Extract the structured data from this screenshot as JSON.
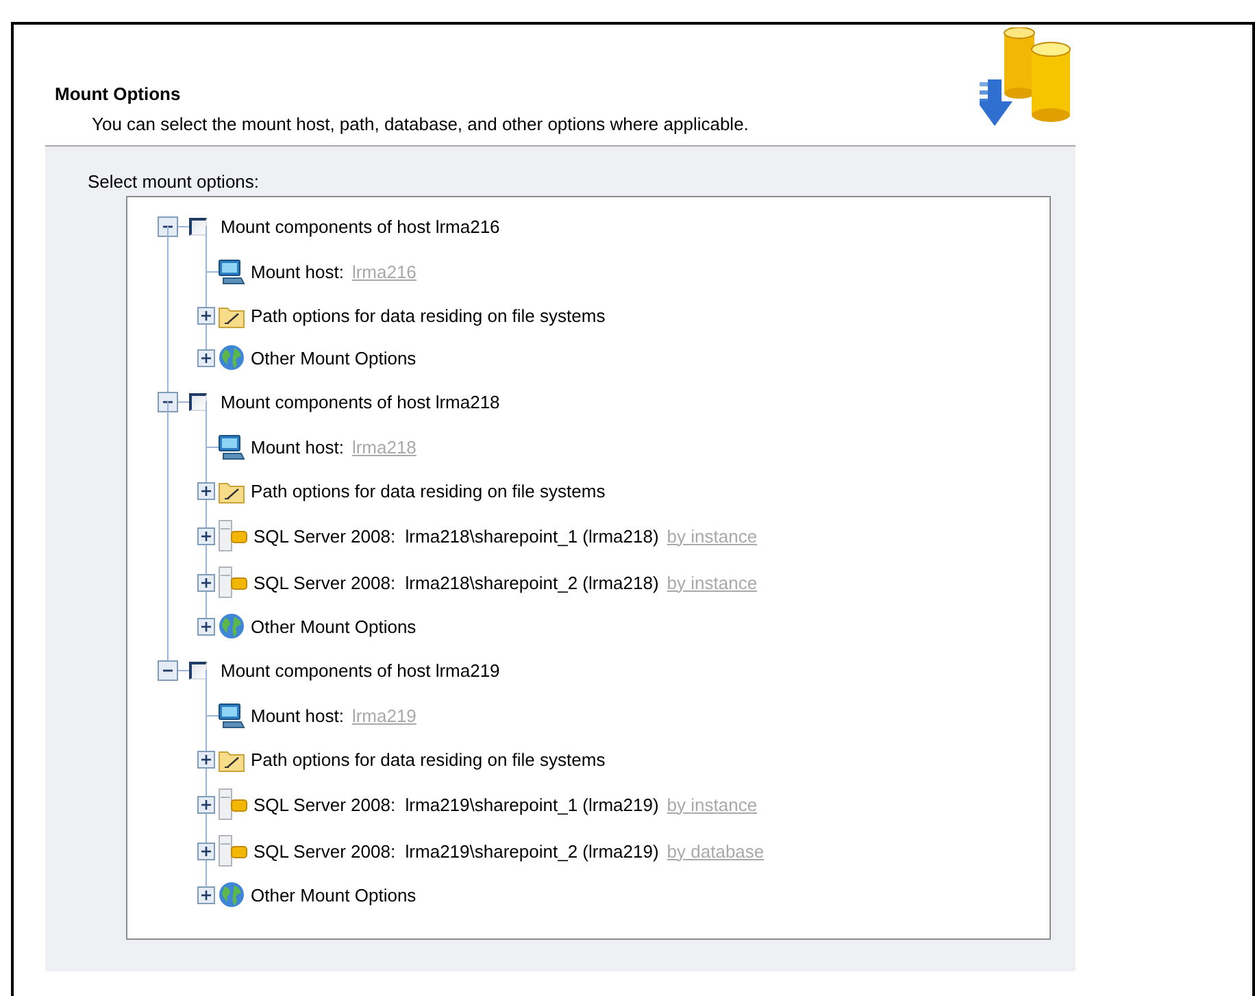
{
  "panel": {
    "title": "Mount Options",
    "description": "You can select the mount host, path, database, and other options where applicable.",
    "tree_label": "Select mount options:"
  },
  "tree": [
    {
      "kind": "host",
      "label": "Mount components of host lrma216",
      "expanded": true,
      "checked": false,
      "children": [
        {
          "kind": "mount_host",
          "label": "Mount host:",
          "value": "lrma216"
        },
        {
          "kind": "path",
          "label": "Path options for data residing on file systems",
          "expanded": false
        },
        {
          "kind": "other",
          "label": "Other Mount Options",
          "expanded": false
        }
      ]
    },
    {
      "kind": "host",
      "label": "Mount components of host lrma218",
      "expanded": true,
      "checked": false,
      "children": [
        {
          "kind": "mount_host",
          "label": "Mount host:",
          "value": "lrma218"
        },
        {
          "kind": "path",
          "label": "Path options for data residing on file systems",
          "expanded": false
        },
        {
          "kind": "sql",
          "label": "SQL Server 2008:  lrma218\\sharepoint_1 (lrma218)",
          "link": "by instance",
          "expanded": false
        },
        {
          "kind": "sql",
          "label": "SQL Server 2008:  lrma218\\sharepoint_2 (lrma218)",
          "link": "by instance",
          "expanded": false
        },
        {
          "kind": "other",
          "label": "Other Mount Options",
          "expanded": false
        }
      ]
    },
    {
      "kind": "host",
      "label": "Mount components of host lrma219",
      "expanded": true,
      "checked": false,
      "children": [
        {
          "kind": "mount_host",
          "label": "Mount host:",
          "value": "lrma219"
        },
        {
          "kind": "path",
          "label": "Path options for data residing on file systems",
          "expanded": false
        },
        {
          "kind": "sql",
          "label": "SQL Server 2008:  lrma219\\sharepoint_1 (lrma219)",
          "link": "by instance",
          "expanded": false
        },
        {
          "kind": "sql",
          "label": "SQL Server 2008:  lrma219\\sharepoint_2 (lrma219)",
          "link": "by database",
          "expanded": false
        },
        {
          "kind": "other",
          "label": "Other Mount Options",
          "expanded": false
        }
      ]
    }
  ]
}
